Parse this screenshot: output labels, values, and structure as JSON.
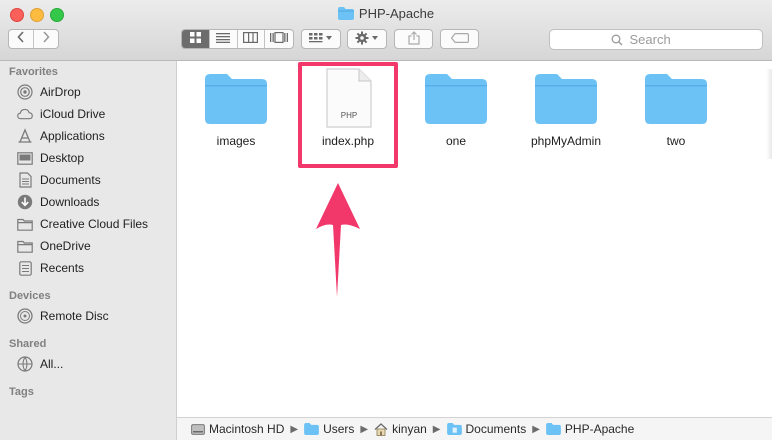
{
  "window": {
    "title": "PHP-Apache"
  },
  "toolbar": {
    "search_placeholder": "Search"
  },
  "sidebar": {
    "favorites_label": "Favorites",
    "favorites": [
      {
        "label": "AirDrop",
        "icon": "airdrop-icon"
      },
      {
        "label": "iCloud Drive",
        "icon": "cloud-icon"
      },
      {
        "label": "Applications",
        "icon": "applications-icon"
      },
      {
        "label": "Desktop",
        "icon": "desktop-icon"
      },
      {
        "label": "Documents",
        "icon": "document-icon"
      },
      {
        "label": "Downloads",
        "icon": "download-icon"
      },
      {
        "label": "Creative Cloud Files",
        "icon": "folder-icon"
      },
      {
        "label": "OneDrive",
        "icon": "folder-icon"
      },
      {
        "label": "Recents",
        "icon": "recents-icon"
      }
    ],
    "devices_label": "Devices",
    "devices": [
      {
        "label": "Remote Disc",
        "icon": "disc-icon"
      }
    ],
    "shared_label": "Shared",
    "shared": [
      {
        "label": "All...",
        "icon": "network-icon"
      }
    ],
    "tags_label": "Tags"
  },
  "content": {
    "items": [
      {
        "label": "images",
        "kind": "folder"
      },
      {
        "label": "index.php",
        "kind": "php-file",
        "badge": "PHP",
        "highlighted": true
      },
      {
        "label": "one",
        "kind": "folder"
      },
      {
        "label": "phpMyAdmin",
        "kind": "folder"
      },
      {
        "label": "two",
        "kind": "folder"
      }
    ]
  },
  "pathbar": {
    "crumbs": [
      {
        "label": "Macintosh HD",
        "icon": "hard-drive-icon"
      },
      {
        "label": "Users",
        "icon": "folder-icon"
      },
      {
        "label": "kinyan",
        "icon": "home-icon"
      },
      {
        "label": "Documents",
        "icon": "documents-folder-icon"
      },
      {
        "label": "PHP-Apache",
        "icon": "folder-icon"
      }
    ]
  },
  "colors": {
    "highlight": "#f2386b",
    "folder": "#6dc2f5",
    "active_view": "#6d6d6d"
  }
}
